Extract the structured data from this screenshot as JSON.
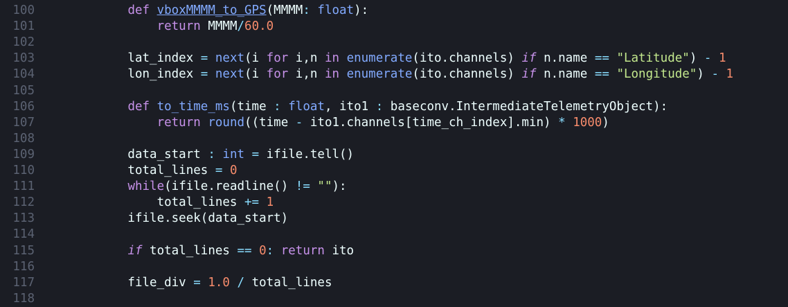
{
  "editor": {
    "language": "python",
    "background": "#1b1d24",
    "lines": [
      {
        "num": "100",
        "tokens": [
          {
            "t": "            ",
            "c": "plain"
          },
          {
            "t": "def",
            "c": "kw"
          },
          {
            "t": " ",
            "c": "plain"
          },
          {
            "t": "vboxMMMM_to_GPS",
            "c": "fnu"
          },
          {
            "t": "(MMMM",
            "c": "plain"
          },
          {
            "t": ": ",
            "c": "op"
          },
          {
            "t": "float",
            "c": "ty"
          },
          {
            "t": "):",
            "c": "plain"
          }
        ]
      },
      {
        "num": "101",
        "tokens": [
          {
            "t": "                ",
            "c": "plain"
          },
          {
            "t": "return",
            "c": "kw"
          },
          {
            "t": " MMMM",
            "c": "plain"
          },
          {
            "t": "/",
            "c": "op"
          },
          {
            "t": "60.0",
            "c": "num"
          }
        ]
      },
      {
        "num": "102",
        "tokens": []
      },
      {
        "num": "103",
        "tokens": [
          {
            "t": "            lat_index ",
            "c": "plain"
          },
          {
            "t": "=",
            "c": "op"
          },
          {
            "t": " ",
            "c": "plain"
          },
          {
            "t": "next",
            "c": "fn"
          },
          {
            "t": "(i ",
            "c": "plain"
          },
          {
            "t": "for",
            "c": "kw"
          },
          {
            "t": " i,n ",
            "c": "plain"
          },
          {
            "t": "in",
            "c": "kw"
          },
          {
            "t": " ",
            "c": "plain"
          },
          {
            "t": "enumerate",
            "c": "fn"
          },
          {
            "t": "(ito.channels) ",
            "c": "plain"
          },
          {
            "t": "if",
            "c": "kwi"
          },
          {
            "t": " n.name ",
            "c": "plain"
          },
          {
            "t": "==",
            "c": "op"
          },
          {
            "t": " ",
            "c": "plain"
          },
          {
            "t": "\"Latitude\"",
            "c": "str"
          },
          {
            "t": ") ",
            "c": "plain"
          },
          {
            "t": "-",
            "c": "op"
          },
          {
            "t": " ",
            "c": "plain"
          },
          {
            "t": "1",
            "c": "num"
          }
        ]
      },
      {
        "num": "104",
        "tokens": [
          {
            "t": "            lon_index ",
            "c": "plain"
          },
          {
            "t": "=",
            "c": "op"
          },
          {
            "t": " ",
            "c": "plain"
          },
          {
            "t": "next",
            "c": "fn"
          },
          {
            "t": "(i ",
            "c": "plain"
          },
          {
            "t": "for",
            "c": "kw"
          },
          {
            "t": " i,n ",
            "c": "plain"
          },
          {
            "t": "in",
            "c": "kw"
          },
          {
            "t": " ",
            "c": "plain"
          },
          {
            "t": "enumerate",
            "c": "fn"
          },
          {
            "t": "(ito.channels) ",
            "c": "plain"
          },
          {
            "t": "if",
            "c": "kwi"
          },
          {
            "t": " n.name ",
            "c": "plain"
          },
          {
            "t": "==",
            "c": "op"
          },
          {
            "t": " ",
            "c": "plain"
          },
          {
            "t": "\"Longitude\"",
            "c": "str"
          },
          {
            "t": ") ",
            "c": "plain"
          },
          {
            "t": "-",
            "c": "op"
          },
          {
            "t": " ",
            "c": "plain"
          },
          {
            "t": "1",
            "c": "num"
          }
        ]
      },
      {
        "num": "105",
        "tokens": []
      },
      {
        "num": "106",
        "tokens": [
          {
            "t": "            ",
            "c": "plain"
          },
          {
            "t": "def",
            "c": "kw"
          },
          {
            "t": " ",
            "c": "plain"
          },
          {
            "t": "to_time_ms",
            "c": "fn"
          },
          {
            "t": "(time ",
            "c": "plain"
          },
          {
            "t": ":",
            "c": "op"
          },
          {
            "t": " ",
            "c": "plain"
          },
          {
            "t": "float",
            "c": "ty"
          },
          {
            "t": ", ito1 ",
            "c": "plain"
          },
          {
            "t": ":",
            "c": "op"
          },
          {
            "t": " baseconv.IntermediateTelemetryObject):",
            "c": "plain"
          }
        ]
      },
      {
        "num": "107",
        "tokens": [
          {
            "t": "                ",
            "c": "plain"
          },
          {
            "t": "return",
            "c": "kw"
          },
          {
            "t": " ",
            "c": "plain"
          },
          {
            "t": "round",
            "c": "fn"
          },
          {
            "t": "((time ",
            "c": "plain"
          },
          {
            "t": "-",
            "c": "op"
          },
          {
            "t": " ito1.channels[time_ch_index].min) ",
            "c": "plain"
          },
          {
            "t": "*",
            "c": "op"
          },
          {
            "t": " ",
            "c": "plain"
          },
          {
            "t": "1000",
            "c": "num"
          },
          {
            "t": ")",
            "c": "plain"
          }
        ]
      },
      {
        "num": "108",
        "tokens": []
      },
      {
        "num": "109",
        "tokens": [
          {
            "t": "            data_start ",
            "c": "plain"
          },
          {
            "t": ":",
            "c": "op"
          },
          {
            "t": " ",
            "c": "plain"
          },
          {
            "t": "int",
            "c": "ty"
          },
          {
            "t": " ",
            "c": "plain"
          },
          {
            "t": "=",
            "c": "op"
          },
          {
            "t": " ifile.tell()",
            "c": "plain"
          }
        ]
      },
      {
        "num": "110",
        "tokens": [
          {
            "t": "            total_lines ",
            "c": "plain"
          },
          {
            "t": "=",
            "c": "op"
          },
          {
            "t": " ",
            "c": "plain"
          },
          {
            "t": "0",
            "c": "num"
          }
        ]
      },
      {
        "num": "111",
        "tokens": [
          {
            "t": "            ",
            "c": "plain"
          },
          {
            "t": "while",
            "c": "kw"
          },
          {
            "t": "(ifile.readline() ",
            "c": "plain"
          },
          {
            "t": "!=",
            "c": "op"
          },
          {
            "t": " ",
            "c": "plain"
          },
          {
            "t": "\"\"",
            "c": "str"
          },
          {
            "t": "):",
            "c": "plain"
          }
        ]
      },
      {
        "num": "112",
        "tokens": [
          {
            "t": "                total_lines ",
            "c": "plain"
          },
          {
            "t": "+=",
            "c": "op"
          },
          {
            "t": " ",
            "c": "plain"
          },
          {
            "t": "1",
            "c": "num"
          }
        ]
      },
      {
        "num": "113",
        "tokens": [
          {
            "t": "            ifile.seek(data_start)",
            "c": "plain"
          }
        ]
      },
      {
        "num": "114",
        "tokens": []
      },
      {
        "num": "115",
        "tokens": [
          {
            "t": "            ",
            "c": "plain"
          },
          {
            "t": "if",
            "c": "kwi"
          },
          {
            "t": " total_lines ",
            "c": "plain"
          },
          {
            "t": "==",
            "c": "op"
          },
          {
            "t": " ",
            "c": "plain"
          },
          {
            "t": "0",
            "c": "num"
          },
          {
            "t": ": ",
            "c": "op"
          },
          {
            "t": "return",
            "c": "kw"
          },
          {
            "t": " ito",
            "c": "plain"
          }
        ]
      },
      {
        "num": "116",
        "tokens": []
      },
      {
        "num": "117",
        "tokens": [
          {
            "t": "            file_div ",
            "c": "plain"
          },
          {
            "t": "=",
            "c": "op"
          },
          {
            "t": " ",
            "c": "plain"
          },
          {
            "t": "1.0",
            "c": "num"
          },
          {
            "t": " ",
            "c": "plain"
          },
          {
            "t": "/",
            "c": "op"
          },
          {
            "t": " total_lines",
            "c": "plain"
          }
        ]
      },
      {
        "num": "118",
        "tokens": []
      }
    ]
  }
}
